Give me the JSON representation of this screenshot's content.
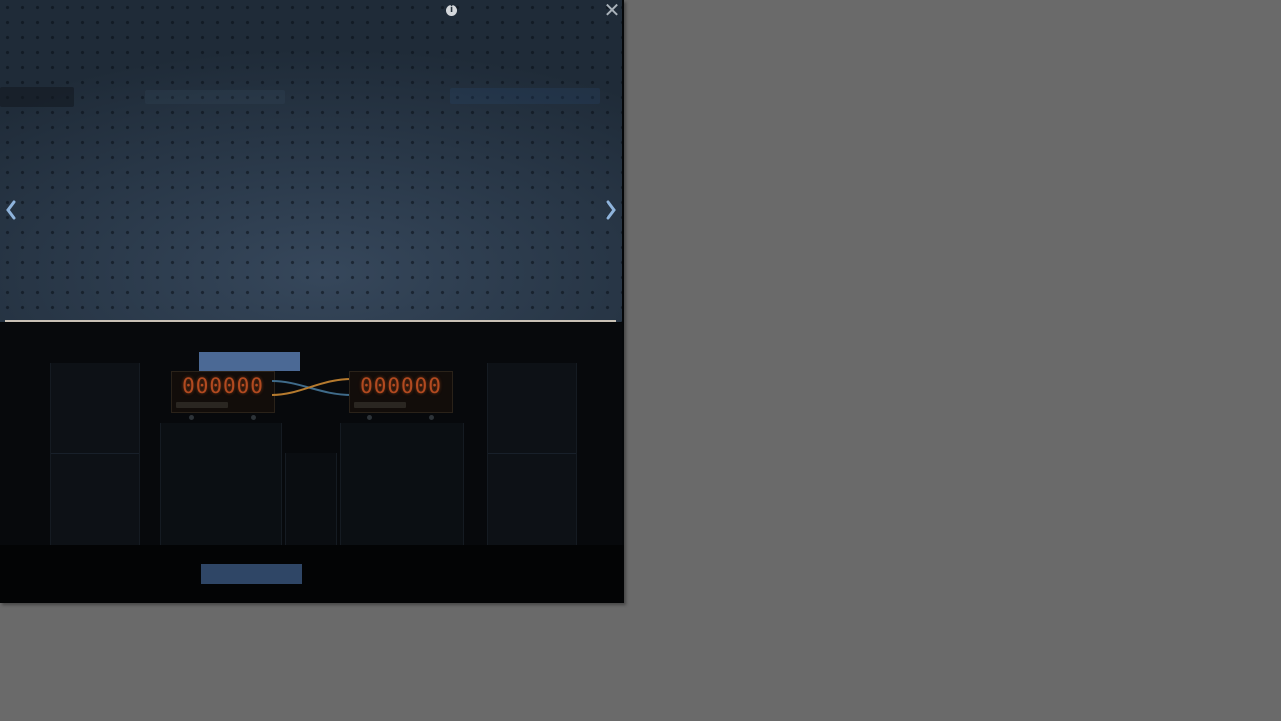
{
  "viewer": {
    "counter_left": "000000",
    "counter_right": "000000",
    "colors": {
      "page_backdrop": "#6a6a6a",
      "preview_bg": "#2b3a4b",
      "accent_blue": "#4b6995",
      "counter_digit": "#b24a20",
      "progress_line": "#c9c1b6"
    },
    "icons": {
      "info": "info-icon",
      "close": "close-icon",
      "prev": "chevron-left-icon",
      "next": "chevron-right-icon"
    }
  }
}
